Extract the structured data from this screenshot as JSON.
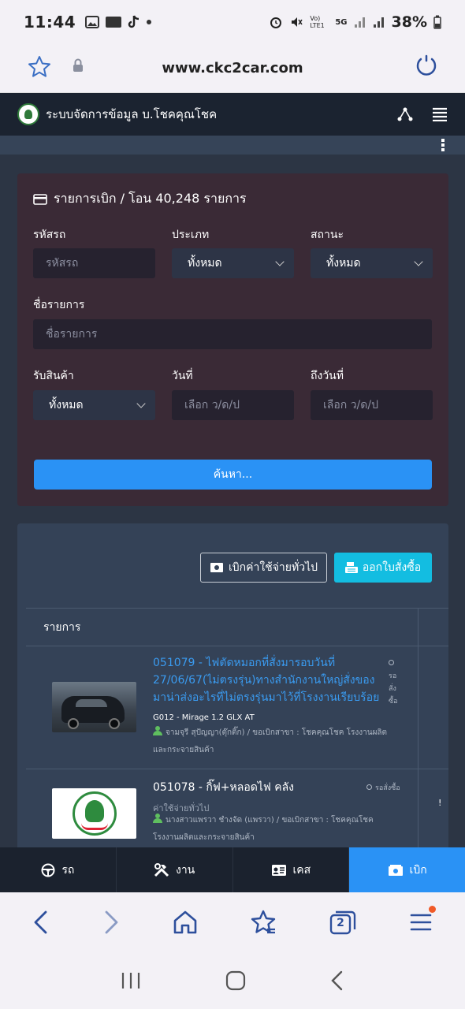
{
  "status_bar": {
    "time": "11:44",
    "battery": "38%",
    "network": "5G",
    "volte": "Vo) LTE1"
  },
  "browser": {
    "url": "www.ckc2car.com",
    "tab_count": "2"
  },
  "app": {
    "title": "ระบบจัดการข้อมูล  บ.โชคคุณโชค"
  },
  "filter": {
    "title": "รายการเบิก / โอน 40,248 รายการ",
    "car_code": {
      "label": "รหัสรถ",
      "placeholder": "รหัสรถ"
    },
    "type": {
      "label": "ประเภท",
      "value": "ทั้งหมด"
    },
    "status": {
      "label": "สถานะ",
      "value": "ทั้งหมด"
    },
    "item_name": {
      "label": "ชื่อรายการ",
      "placeholder": "ชื่อรายการ"
    },
    "receive": {
      "label": "รับสินค้า",
      "value": "ทั้งหมด"
    },
    "date_from": {
      "label": "วันที่",
      "placeholder": "เลือก ว/ด/ป"
    },
    "date_to": {
      "label": "ถึงวันที่",
      "placeholder": "เลือก ว/ด/ป"
    },
    "search_label": "ค้นหา..."
  },
  "actions": {
    "general_expense": "เบิกค่าใช้จ่ายทั่วไป",
    "purchase_order": "ออกใบสั่งซื้อ"
  },
  "table": {
    "header": "รายการ",
    "edge_mark": "!",
    "rows": [
      {
        "title": "051079 - ไฟตัดหมอกที่สั่งมารอบวันที่ 27/06/67(ไม่ตรงรุ่น)ทางสำนักงานใหญ่สั่งของมาน่าส่งอะไรที่ไม่ตรงรุ่นมาไว้ที่โรงงานเรียบร้อย",
        "subtitle": "G012 - Mirage 1.2 GLX AT",
        "meta": "จามจุรี สุปัญญา(ตุ๊กติ๊ก) / ขอเบิกสาขา : โชคคุณโชค โรงงานผลิตและกระจายสินค้า",
        "status": "รอสั่งซื้อ",
        "thumb": "car-photo"
      },
      {
        "title": "051078 - กิ๊ฟ+หลอดไฟ คลัง",
        "subtitle": "ค่าใช้จ่ายทั่วไป",
        "meta": "นางสาวแพรวา ชำงจัด (แพรวา) / ขอเบิกสาขา : โชคคุณโชค โรงงานผลิตและกระจายสินค้า",
        "status": "รอสั่งซื้อ",
        "thumb": "company-logo"
      }
    ]
  },
  "app_nav": [
    {
      "label": "รถ",
      "icon": "steering-wheel-icon"
    },
    {
      "label": "งาน",
      "icon": "tools-icon"
    },
    {
      "label": "เคส",
      "icon": "id-card-icon"
    },
    {
      "label": "เบิก",
      "icon": "money-icon",
      "active": true
    }
  ],
  "colors": {
    "accent": "#2a92f5",
    "cyan": "#13bde1",
    "header": "#1b2330",
    "filter_bg": "#3a2a36",
    "link": "#3a9bf0"
  }
}
